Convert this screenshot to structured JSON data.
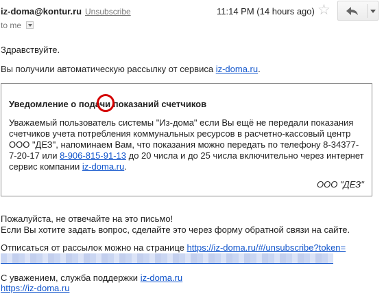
{
  "header": {
    "sender": "iz-doma@kontur.ru",
    "unsubscribe_label": "Unsubscribe",
    "time": "11:14 PM (14 hours ago)",
    "to": "to me"
  },
  "body": {
    "greeting": "Здравствуйте.",
    "auto_prefix": "Вы получили автоматическую рассылку от сервиса ",
    "auto_link": "iz-doma.ru",
    "auto_suffix": ".",
    "notice": {
      "title": "Уведомление о подачи показаний счетчиков",
      "line1": "Уважаемый пользователь системы \"Из-дома\" если Вы ещё не передали показания",
      "line2": "счетчиков учета потребления коммунальных ресурсов в расчетно-кассовый центр",
      "line3": "ООО \"ДЕЗ\",  напоминаем Вам, что показания можно передать по телефону 8-34377-",
      "line4_prefix": "7-20-17 или ",
      "phone_link": "8-906-815-91-13",
      "line4_suffix": " до 20 числа и до 25 числа включительно через интернет",
      "line5_prefix": "сервис компании ",
      "line5_link": "iz-doma.ru",
      "line5_suffix": ".",
      "signature": "ООО \"ДЕЗ\""
    },
    "no_reply": "Пожалуйста, не отвечайте на это письмо!",
    "feedback": "Если Вы хотите задать вопрос, сделайте это через форму обратной связи на сайте.",
    "unsub_prefix": "Отписаться от рассылок можно на странице ",
    "unsub_link": "https://iz-doma.ru/#/unsubscribe?token=",
    "regards_prefix": "С уважением, служба поддержки ",
    "regards_link": "iz-doma.ru",
    "site_link": "https://iz-doma.ru"
  },
  "colors": {
    "link": "#1155cc",
    "highlight_circle": "#d40000"
  },
  "icons": {
    "star": "star-icon",
    "reply": "reply-icon",
    "dropdown": "chevron-down-icon"
  }
}
